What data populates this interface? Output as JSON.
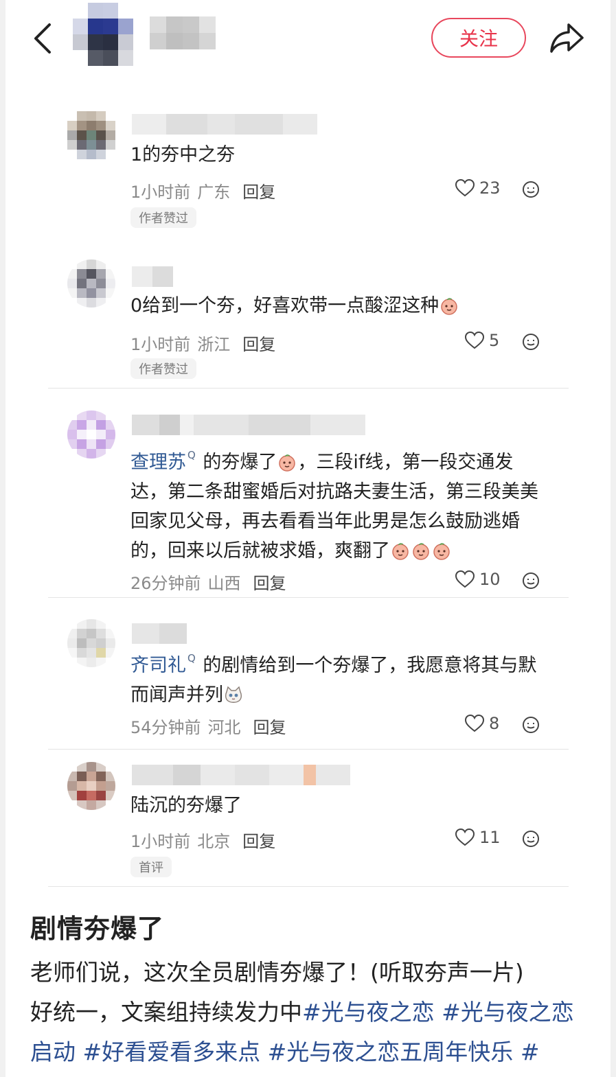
{
  "header": {
    "follow_label": "关注"
  },
  "comments": [
    {
      "text": "1的夯中之夯",
      "time": "1小时前",
      "location": "广东",
      "reply": "回复",
      "likes": "23",
      "badge": "作者赞过"
    },
    {
      "text": "0给到一个夯，好喜欢带一点酸涩这种",
      "time": "1小时前",
      "location": "浙江",
      "reply": "回复",
      "likes": "5",
      "badge": "作者赞过"
    },
    {
      "mention": "查理苏",
      "text_line1": "的夯爆了",
      "text_line1b": "，三段if线，第一段交通发",
      "text_line2": "达，第二条甜蜜婚后对抗路夫妻生活，第三段美美",
      "text_line3": "回家见父母，再去看看当年此男是怎么鼓励逃婚",
      "text_line4": "的，回来以后就被求婚，爽翻了",
      "time": "26分钟前",
      "location": "山西",
      "reply": "回复",
      "likes": "10"
    },
    {
      "mention": "齐司礼",
      "text_line1": "的剧情给到一个夯爆了，我愿意将其与默",
      "text_line2": "而闻声并列",
      "time": "54分钟前",
      "location": "河北",
      "reply": "回复",
      "likes": "8"
    },
    {
      "text": "陆沉的夯爆了",
      "time": "1小时前",
      "location": "北京",
      "reply": "回复",
      "likes": "11",
      "badge": "首评"
    }
  ],
  "post": {
    "title": "剧情夯爆了",
    "body_line1": "老师们说，这次全员剧情夯爆了！(听取夯声一片)",
    "body_line2_prefix": "好统一，文案组持续发力中",
    "tags": [
      "#光与夜之恋",
      "#光与夜之恋启动",
      "#好看爱看多来点",
      "#光与夜之恋五周年快乐",
      "#"
    ]
  }
}
